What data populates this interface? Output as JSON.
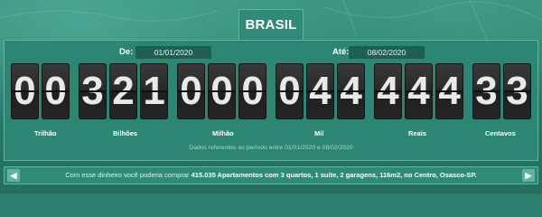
{
  "header": {
    "tab_label": "BRASIL"
  },
  "period": {
    "from_label": "De:",
    "from_value": "01/01/2020",
    "to_label": "Até:",
    "to_value": "08/02/2020"
  },
  "counter": {
    "digits": [
      "0",
      "0",
      "3",
      "2",
      "1",
      "0",
      "0",
      "0",
      "0",
      "4",
      "4",
      "4",
      "4",
      "4",
      "3",
      "3"
    ],
    "units": [
      "Trilhão",
      "Bilhões",
      "Milhão",
      "Mil",
      "Reais",
      "Centavos"
    ]
  },
  "note": "Dados referentes ao período entre 01/01/2020 e 08/02/2020",
  "purchase": {
    "prefix": "Com esse dinheiro você poderia comprar",
    "highlight": "415.035 Apartamentos com 3 quartos, 1 suíte, 2 garagens, 116m2, no Centro, Osasco-SP."
  },
  "icons": {
    "prev": "chevron-left-icon",
    "next": "chevron-right-icon"
  },
  "colors": {
    "background": "#2c7f6e",
    "panel": "#2d8673",
    "border": "#5fb3a2",
    "digit_bg": "#2a2a2a"
  }
}
